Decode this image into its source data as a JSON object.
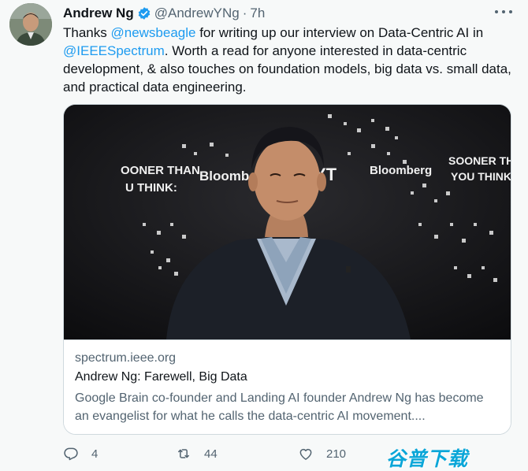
{
  "tweet": {
    "author_name": "Andrew Ng",
    "handle": "@AndrewYNg",
    "separator": "·",
    "time": "7h",
    "verified_icon": "verified-badge-icon",
    "text_prefix": "Thanks ",
    "mention_1": "@newsbeagle",
    "text_middle": " for writing up our interview on Data-Centric AI in ",
    "mention_2": "@IEEESpectrum",
    "text_suffix": ". Worth a read for anyone interested in data-centric development, & also touches on foundation models, big data vs. small data, and practical data engineering."
  },
  "card": {
    "domain": "spectrum.ieee.org",
    "title": "Andrew Ng: Farewell, Big Data",
    "description": "Google Brain co-founder and Landing AI founder Andrew Ng has become an evangelist for what he calls the data-centric AI movement....",
    "image_texts": {
      "left_1": "OONER THAN",
      "left_2": "U THINK:",
      "center_1": "Bloomberg",
      "center_2": "YT",
      "right_brand": "Bloomberg",
      "right_1": "SOONER THAN",
      "right_2": "YOU THINK:"
    }
  },
  "actions": {
    "replies": "4",
    "retweets": "44",
    "likes": "210"
  },
  "watermark": "谷普下载",
  "colors": {
    "accent": "#1d9bf0",
    "secondary_text": "#536471",
    "border": "#cfd9de",
    "background": "#f7f9f9"
  }
}
